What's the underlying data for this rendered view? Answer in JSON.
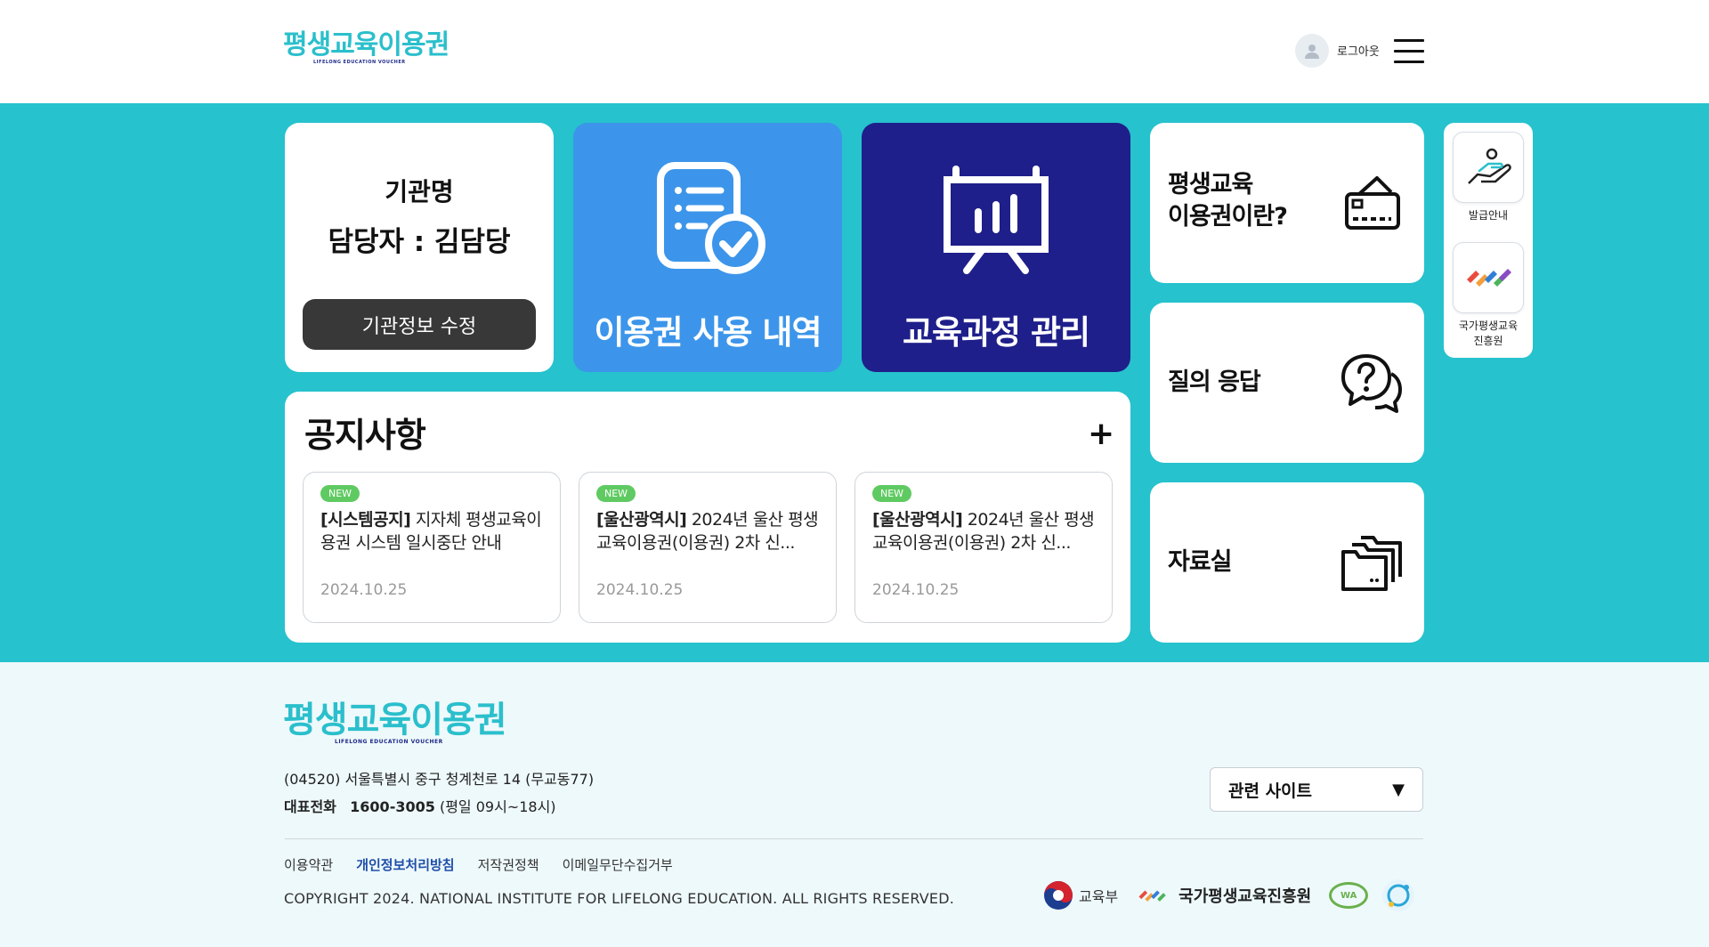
{
  "header": {
    "logo_text": "평생교육이용권",
    "logo_sub": "LIFELONG EDUCATION VOUCHER",
    "logout_label": "로그아웃"
  },
  "org_card": {
    "org_name": "기관명",
    "manager": "담당자 : 김담당",
    "edit_button": "기관정보 수정"
  },
  "tiles": {
    "usage_history": "이용권 사용 내역",
    "course_management": "교육과정 관리"
  },
  "side_menu": [
    {
      "line1": "평생교육",
      "line2": "이용권이란?",
      "icon": "card-icon"
    },
    {
      "line1": "질의 응답",
      "icon": "question-chat-icon"
    },
    {
      "line1": "자료실",
      "icon": "folder-icon"
    }
  ],
  "quick_links": [
    {
      "label": "발급안내",
      "icon": "hand-person-icon"
    },
    {
      "label1": "국가평생교육",
      "label2": "진흥원",
      "icon": "nile-logo-icon"
    }
  ],
  "notices": {
    "title": "공지사항",
    "more_icon": "plus-icon",
    "items": [
      {
        "badge": "NEW",
        "category": "[시스템공지]",
        "title": " 지자체 평생교육이용권 시스템 일시중단 안내",
        "date": "2024.10.25"
      },
      {
        "badge": "NEW",
        "category": "[울산광역시]",
        "title": " 2024년 울산 평생교육이용권(이용권) 2차 신...",
        "date": "2024.10.25"
      },
      {
        "badge": "NEW",
        "category": "[울산광역시]",
        "title": " 2024년 울산 평생교육이용권(이용권) 2차 신...",
        "date": "2024.10.25"
      }
    ]
  },
  "footer": {
    "logo_text": "평생교육이용권",
    "logo_sub": "LIFELONG EDUCATION VOUCHER",
    "address": "(04520) 서울특별시 중구 청계천로 14 (무교동77)",
    "phone_label": "대표전화",
    "phone_number": "1600-3005",
    "phone_hours": "(평일 09시~18시)",
    "related_sites": "관련 사이트",
    "links": [
      "이용약관",
      "개인정보처리방침",
      "저작권정책",
      "이메일무단수집거부"
    ],
    "copyright": "COPYRIGHT 2024. NATIONAL INSTITUTE FOR LIFELONG EDUCATION. ALL RIGHTS RESERVED.",
    "partners": {
      "moe": "교육부",
      "nile": "국가평생교육진흥원",
      "wa": "WA"
    }
  },
  "colors": {
    "teal": "#26c2cd",
    "blue": "#3c95ea",
    "navy": "#1f1f8b",
    "new_badge": "#5fca62"
  }
}
